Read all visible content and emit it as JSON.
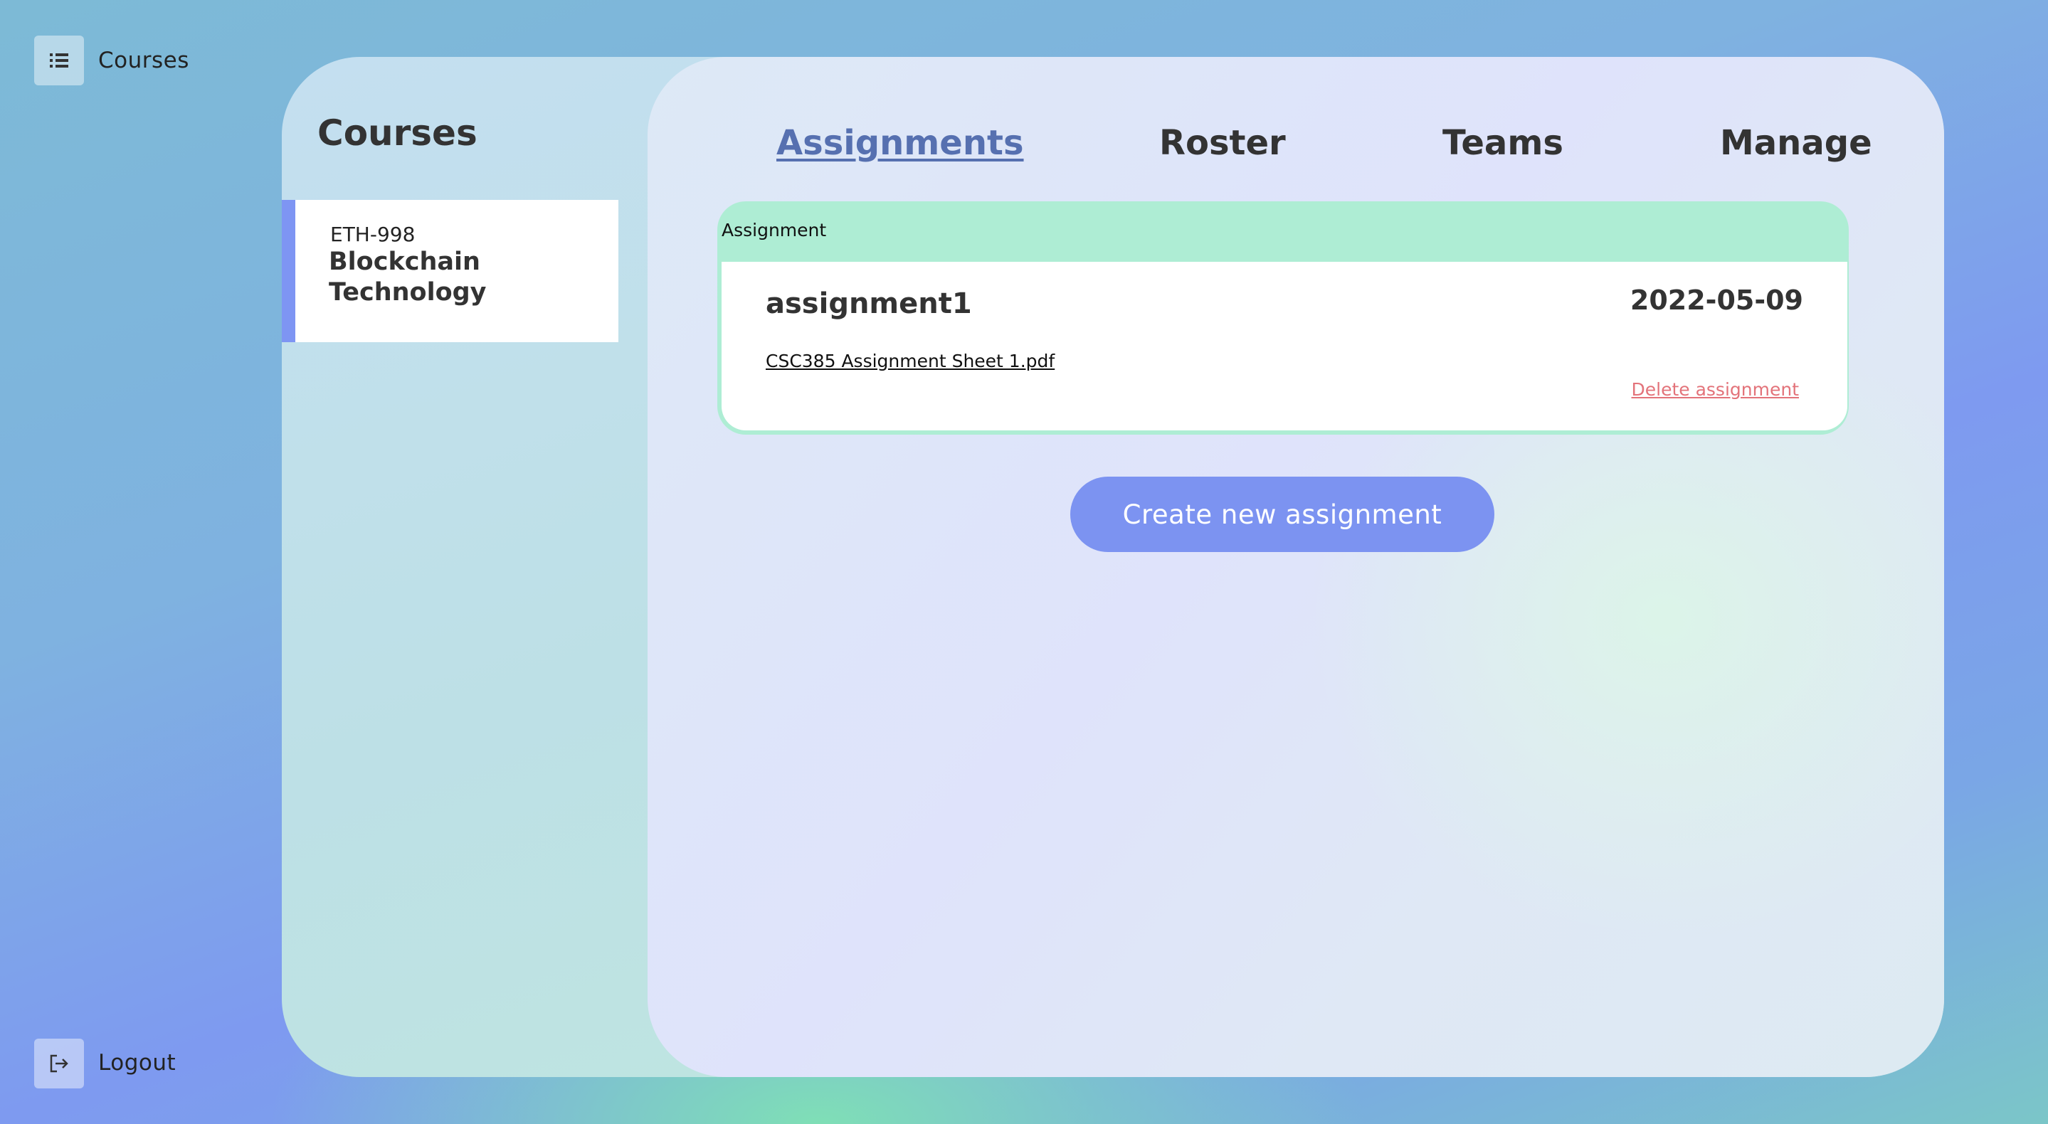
{
  "nav": {
    "courses_label": "Courses",
    "logout_label": "Logout",
    "courses_icon": "list-icon",
    "logout_icon": "logout-icon"
  },
  "sidebar": {
    "heading": "Courses",
    "courses": [
      {
        "code": "ETH-998",
        "name": "Blockchain Technology",
        "selected": true
      }
    ]
  },
  "tabs": [
    {
      "label": "Assignments",
      "active": true
    },
    {
      "label": "Roster",
      "active": false
    },
    {
      "label": "Teams",
      "active": false
    },
    {
      "label": "Manage",
      "active": false
    }
  ],
  "assignments": {
    "header_label": "Assignment",
    "items": [
      {
        "title": "assignment1",
        "due_date": "2022-05-09",
        "file": "CSC385 Assignment Sheet 1.pdf",
        "delete_label": "Delete assignment"
      }
    ]
  },
  "create_button_label": "Create new assignment",
  "colors": {
    "accent": "#7c93f1",
    "active_tab": "#5670b0",
    "assignment_header": "#aeedd4",
    "delete_link": "#e3737a"
  }
}
